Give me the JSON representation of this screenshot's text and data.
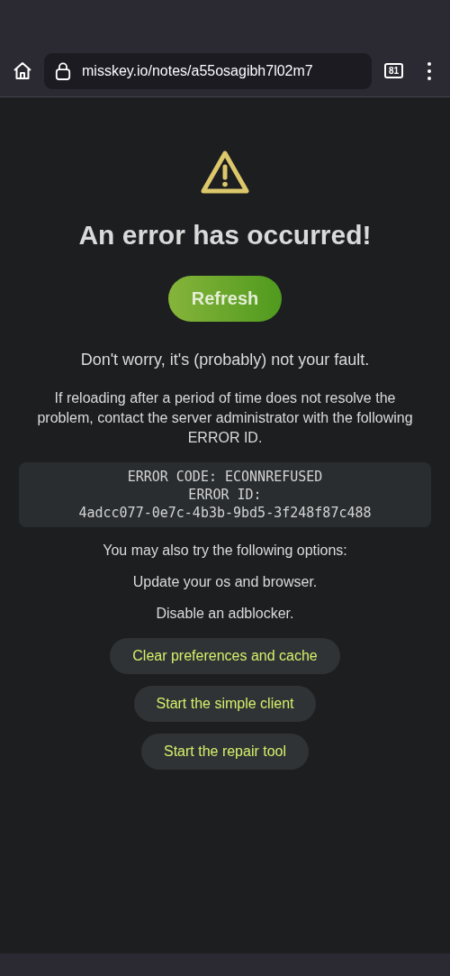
{
  "browser": {
    "url": "misskey.io/notes/a55osagibh7l02m7",
    "tab_count": "81"
  },
  "error": {
    "title": "An error has occurred!",
    "refresh_button": "Refresh",
    "reassurance": "Don't worry, it's (probably) not your fault.",
    "instructions": "If reloading after a period of time does not resolve the problem, contact the server administrator with the following ERROR ID.",
    "details": [
      "ERROR CODE: ECONNREFUSED",
      "ERROR ID:",
      "4adcc077-0e7c-4b3b-9bd5-3f248f87c488"
    ]
  },
  "options_intro": "You may also try the following options:",
  "suggestions": [
    "Update your os and browser.",
    "Disable an adblocker."
  ],
  "option_buttons": [
    "Clear preferences and cache",
    "Start the simple client",
    "Start the repair tool"
  ]
}
